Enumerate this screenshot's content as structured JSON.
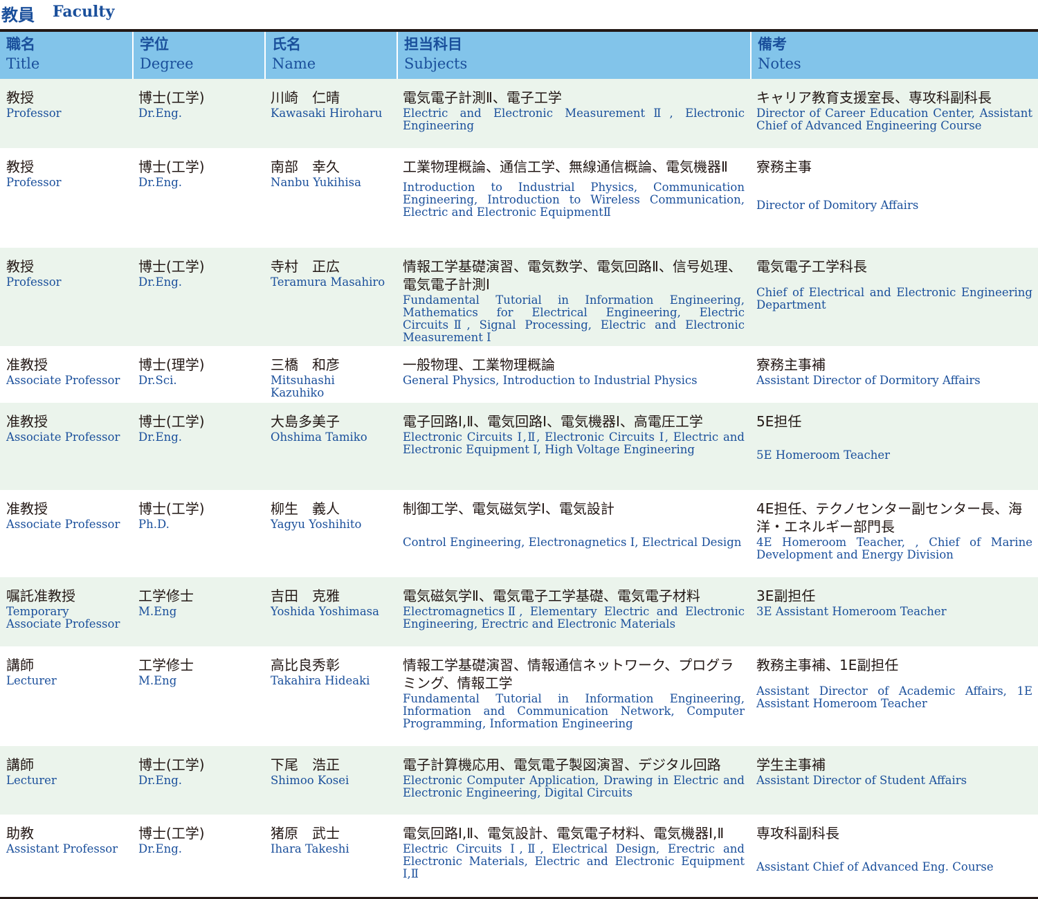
{
  "section": {
    "title_jp": "教員",
    "title_en": "Faculty"
  },
  "headers": [
    {
      "jp": "職名",
      "en": "Title"
    },
    {
      "jp": "学位",
      "en": "Degree"
    },
    {
      "jp": "氏名",
      "en": "Name"
    },
    {
      "jp": "担当科目",
      "en": "Subjects"
    },
    {
      "jp": "備考",
      "en": "Notes"
    }
  ],
  "rows": [
    {
      "title_jp": "教授",
      "title_en": "Professor",
      "degree_jp": "博士(工学)",
      "degree_en": "Dr.Eng.",
      "name_jp": "川崎　仁晴",
      "name_en": "Kawasaki Hiroharu",
      "subjects_jp": "電気電子計測Ⅱ、電子工学",
      "subjects_en": "Electric and Electronic MeasurementⅡ, Electronic Engineering",
      "notes_jp": "キャリア教育支援室長、専攻科副科長",
      "notes_en": "Director of Career Education Center, Assistant Chief of Advanced Engineering Course"
    },
    {
      "title_jp": "教授",
      "title_en": "Professor",
      "degree_jp": "博士(工学)",
      "degree_en": "Dr.Eng.",
      "name_jp": "南部　幸久",
      "name_en": "Nanbu Yukihisa",
      "subjects_jp": "工業物理概論、通信工学、無線通信概論、電気機器Ⅱ",
      "subjects_en": "Introduction to Industrial Physics, Communication Engineering, Introduction to Wireless Communication, Electric and Electronic EquipmentⅡ",
      "notes_jp": "寮務主事",
      "notes_en": "Director of Domitory Affairs"
    },
    {
      "title_jp": "教授",
      "title_en": "Professor",
      "degree_jp": "博士(工学)",
      "degree_en": "Dr.Eng.",
      "name_jp": "寺村　正広",
      "name_en": "Teramura Masahiro",
      "subjects_jp": "情報工学基礎演習、電気数学、電気回路Ⅱ、信号処理、電気電子計測Ⅰ",
      "subjects_en": "Fundamental Tutorial in Information Engineering, Mathematics for Electrical Engineering, Electric CircuitsⅡ, Signal Processing, Electric and Electronic Measurement Ⅰ",
      "notes_jp": "電気電子工学科長",
      "notes_en": "Chief of Electrical and Electronic Engineering Department"
    },
    {
      "title_jp": "准教授",
      "title_en": "Associate Professor",
      "degree_jp": "博士(理学)",
      "degree_en": "Dr.Sci.",
      "name_jp": "三橋　和彦",
      "name_en": "Mitsuhashi Kazuhiko",
      "subjects_jp": "一般物理、工業物理概論",
      "subjects_en": "General Physics, Introduction to Industrial Physics",
      "notes_jp": "寮務主事補",
      "notes_en": "Assistant Director of Dormitory Affairs"
    },
    {
      "title_jp": "准教授",
      "title_en": "Associate Professor",
      "degree_jp": "博士(工学)",
      "degree_en": "Dr.Eng.",
      "name_jp": "大島多美子",
      "name_en": "Ohshima Tamiko",
      "subjects_jp": "電子回路Ⅰ,Ⅱ、電気回路Ⅰ、電気機器Ⅰ、高電圧工学",
      "subjects_en": "Electronic Circuits Ⅰ,Ⅱ, Electronic Circuits Ⅰ, Electric and Electronic Equipment Ⅰ, High Voltage Engineering",
      "notes_jp": "5E担任",
      "notes_en": "5E Homeroom Teacher"
    },
    {
      "title_jp": "准教授",
      "title_en": "Associate Professor",
      "degree_jp": "博士(工学)",
      "degree_en": "Ph.D.",
      "name_jp": "柳生　義人",
      "name_en": "Yagyu Yoshihito",
      "subjects_jp": "制御工学、電気磁気学Ⅰ、電気設計",
      "subjects_en": "Control Engineering, Electronagnetics Ⅰ, Electrical Design",
      "notes_jp": "4E担任、テクノセンター副センター長、海洋・エネルギー部門長",
      "notes_en": "4E Homeroom Teacher, , Chief of Marine Development and Energy Division"
    },
    {
      "title_jp": "嘱託准教授",
      "title_en": "Temporary Associate Professor",
      "degree_jp": "工学修士",
      "degree_en": "M.Eng",
      "name_jp": "吉田　克雅",
      "name_en": "Yoshida Yoshimasa",
      "subjects_jp": "電気磁気学Ⅱ、電気電子工学基礎、電気電子材料",
      "subjects_en": "ElectromagneticsⅡ, Elementary Electric and Electronic Engineering, Erectric and Electronic Materials",
      "notes_jp": "3E副担任",
      "notes_en": "3E Assistant Homeroom Teacher"
    },
    {
      "title_jp": "講師",
      "title_en": "Lecturer",
      "degree_jp": "工学修士",
      "degree_en": "M.Eng",
      "name_jp": "高比良秀彰",
      "name_en": "Takahira Hideaki",
      "subjects_jp": "情報工学基礎演習、情報通信ネットワーク、プログラミング、情報工学",
      "subjects_en": "Fundamental Tutorial in Information Engineering, Information and Communication Network, Computer Programming, Information Engineering",
      "notes_jp": "教務主事補、1E副担任",
      "notes_en": "Assistant Director of Academic Affairs, 1E Assistant Homeroom Teacher"
    },
    {
      "title_jp": "講師",
      "title_en": "Lecturer",
      "degree_jp": "博士(工学)",
      "degree_en": "Dr.Eng.",
      "name_jp": "下尾　浩正",
      "name_en": "Shimoo Kosei",
      "subjects_jp": "電子計算機応用、電気電子製図演習、デジタル回路",
      "subjects_en": "Electronic Computer Application, Drawing in Electric and Electronic Engineering, Digital Circuits",
      "notes_jp": "学生主事補",
      "notes_en": "Assistant Director of Student Affairs"
    },
    {
      "title_jp": "助教",
      "title_en": "Assistant Professor",
      "degree_jp": "博士(工学)",
      "degree_en": "Dr.Eng.",
      "name_jp": "猪原　武士",
      "name_en": "Ihara Takeshi",
      "subjects_jp": "電気回路Ⅰ,Ⅱ、電気設計、電気電子材料、電気機器Ⅰ,Ⅱ",
      "subjects_en": "Electric Circuits Ⅰ,Ⅱ, Electrical Design, Erectric and Electronic Materials, Electric and Electronic Equipment Ⅰ,Ⅱ",
      "notes_jp": "専攻科副科長",
      "notes_en": "Assistant Chief of Advanced Eng. Course"
    }
  ]
}
